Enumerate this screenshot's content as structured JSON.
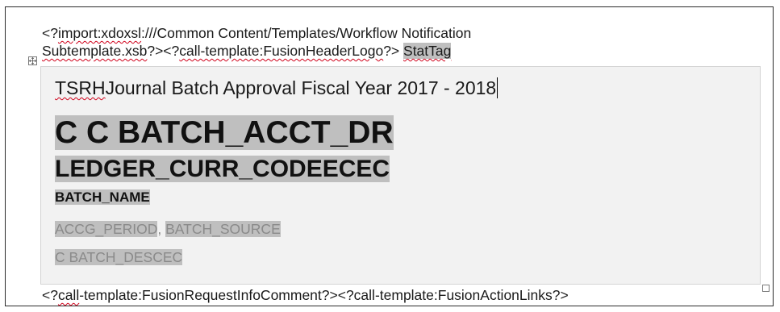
{
  "template": {
    "line1": {
      "prefix": "<?",
      "import_token": "import:xdoxsl",
      "rest": ":///Common Content/Templates/Workflow Notification"
    },
    "line2": {
      "subtemplate": "Subtemplate.xsb",
      "middle": "?><?",
      "call_header": "call-template:FusionHeaderLogo",
      "close": "?> ",
      "stattag": "StatTag"
    },
    "cell": {
      "title_prefix": "TSRH",
      "title_rest": "Journal Batch Approval Fiscal Year 2017 - 2018",
      "batch_acct_dr": "C C BATCH_ACCT_DR",
      "ledger_curr_code": "LEDGER_CURR_CODEECEC",
      "batch_name": "BATCH_NAME",
      "accg_period": "ACCG_PERIOD",
      "separator": ", ",
      "batch_source": "BATCH_SOURCE",
      "batch_desc": "C BATCH_DESCEC"
    },
    "footer": {
      "prefix": "<?",
      "call_token": "call",
      "rest": "-template:FusionRequestInfoComment?><?call-template:FusionActionLinks?>"
    }
  },
  "icons": {
    "move_handle": "move-arrows-icon",
    "resize_handle": "resize-square-icon"
  },
  "colors": {
    "field_shading": "#bfbfbf",
    "cell_background": "#f2f2f2",
    "spellcheck_underline": "#d0021b",
    "grey_text": "#8a8a8a"
  }
}
